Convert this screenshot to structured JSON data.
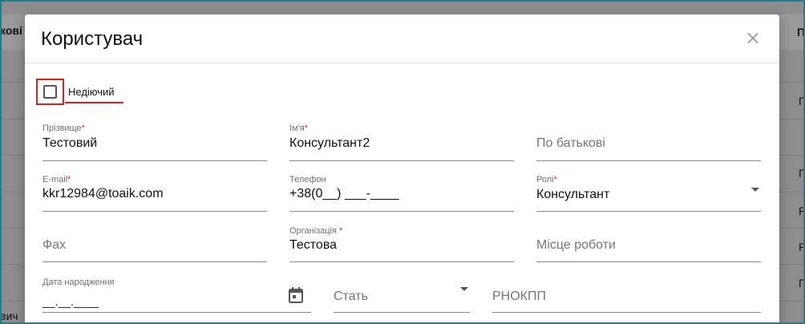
{
  "background": {
    "header_left": "кові",
    "header_right": "П",
    "row_suffixes": [
      "П",
      "П",
      "Р",
      "Р",
      "П"
    ],
    "bottom_left": "вич"
  },
  "modal": {
    "title": "Користувач",
    "close_icon": "close-icon"
  },
  "inactive": {
    "label": "Недіючий",
    "checked": false
  },
  "fields": {
    "surname": {
      "label": "Прізвище",
      "required": "*",
      "value": "Тестовий"
    },
    "first_name": {
      "label": "Ім'я",
      "required": "*",
      "value": "Консультант2"
    },
    "patronymic": {
      "placeholder": "По батькові"
    },
    "email": {
      "label": "E-mail",
      "required": "*",
      "value": "kkr12984@toaik.com"
    },
    "phone": {
      "label": "Телефон",
      "value": "+38(0__) ___-____"
    },
    "roles": {
      "label": "Ролі",
      "required": "*",
      "value": "Консультант"
    },
    "fax": {
      "placeholder": "Фах"
    },
    "organization": {
      "label": "Організація",
      "required": " *",
      "value": "Тестова"
    },
    "workplace": {
      "placeholder": "Місце роботи"
    },
    "birth_date": {
      "label": "Дата народження",
      "value": "__.__.____"
    },
    "gender": {
      "placeholder": "Стать"
    },
    "rnokpp": {
      "placeholder": "РНОКПП"
    }
  },
  "colors": {
    "highlight": "#e0201f",
    "required": "#d32f2f",
    "frame": "#2b7a8c"
  }
}
